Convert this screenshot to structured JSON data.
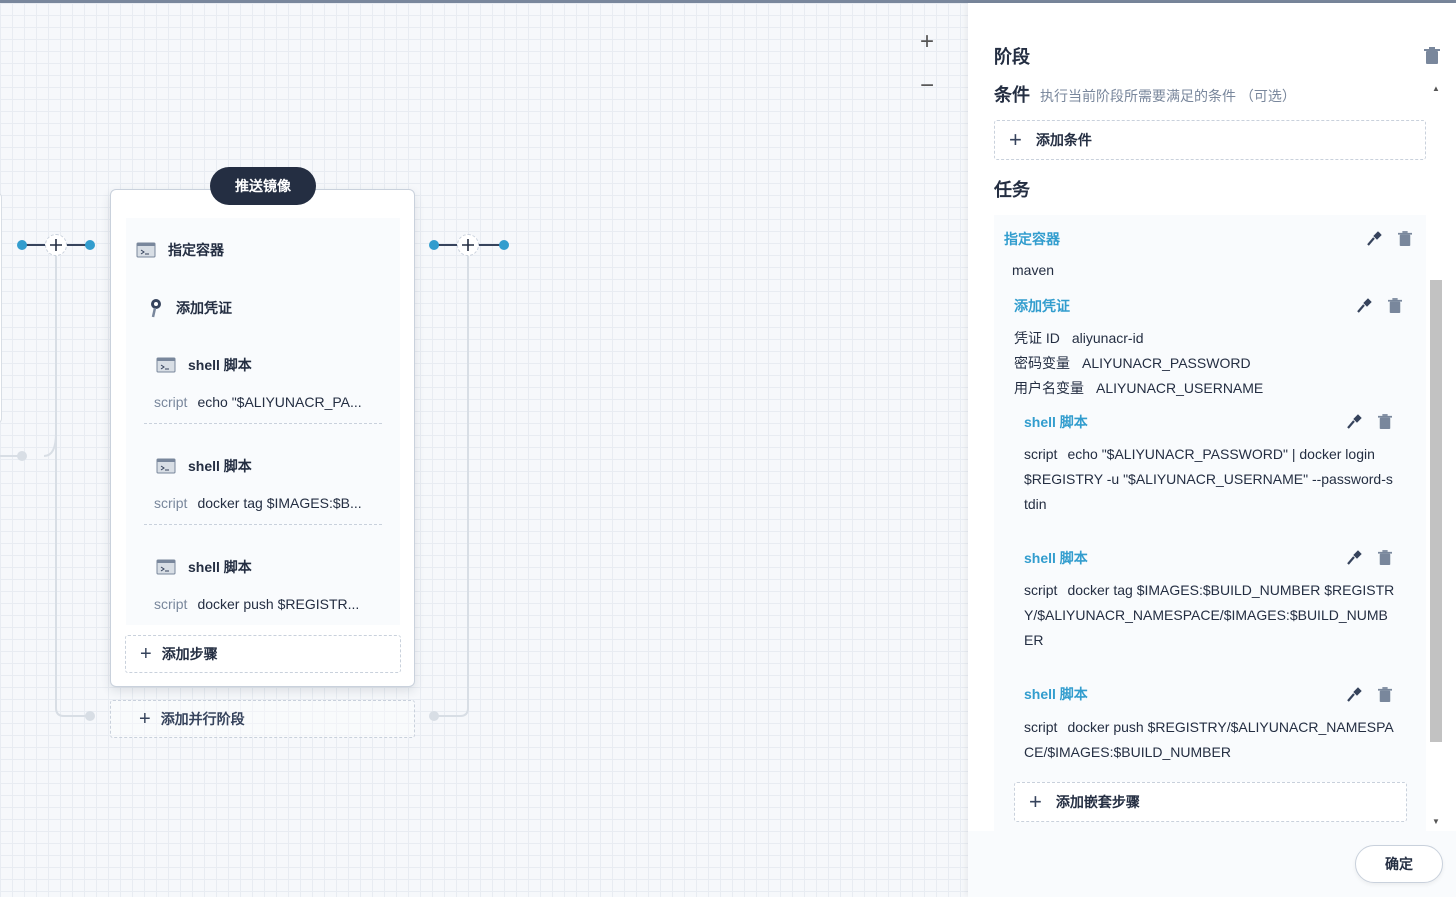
{
  "canvas": {
    "zoom_in_label": "+",
    "zoom_out_label": "−",
    "stage": {
      "title": "推送镜像",
      "steps": [
        {
          "title": "指定容器",
          "icon": "terminal-icon"
        },
        {
          "title": "添加凭证",
          "icon": "key-icon"
        },
        {
          "title": "shell 脚本",
          "icon": "terminal-icon",
          "script_key": "script",
          "script_value": "echo \"$ALIYUNACR_PA..."
        },
        {
          "title": "shell 脚本",
          "icon": "terminal-icon",
          "script_key": "script",
          "script_value": "docker tag $IMAGES:$B..."
        },
        {
          "title": "shell 脚本",
          "icon": "terminal-icon",
          "script_key": "script",
          "script_value": "docker push $REGISTR..."
        }
      ],
      "add_step_label": "添加步骤"
    },
    "add_parallel_label": "添加并行阶段"
  },
  "panel": {
    "title": "阶段",
    "condition_label": "条件",
    "condition_desc": "执行当前阶段所需要满足的条件 （可选）",
    "add_condition_label": "添加条件",
    "task_label": "任务",
    "container": {
      "title": "指定容器",
      "value": "maven"
    },
    "credential": {
      "title": "添加凭证",
      "fields": [
        {
          "key": "凭证 ID",
          "value": "aliyunacr-id"
        },
        {
          "key": "密码变量",
          "value": "ALIYUNACR_PASSWORD"
        },
        {
          "key": "用户名变量",
          "value": "ALIYUNACR_USERNAME"
        }
      ]
    },
    "shell_steps": [
      {
        "title": "shell 脚本",
        "key": "script",
        "value": "echo \"$ALIYUNACR_PASSWORD\" | docker login $REGISTRY -u \"$ALIYUNACR_USERNAME\" --password-stdin"
      },
      {
        "title": "shell 脚本",
        "key": "script",
        "value": "docker tag $IMAGES:$BUILD_NUMBER $REGISTRY/$ALIYUNACR_NAMESPACE/$IMAGES:$BUILD_NUMBER"
      },
      {
        "title": "shell 脚本",
        "key": "script",
        "value": "docker push $REGISTRY/$ALIYUNACR_NAMESPACE/$IMAGES:$BUILD_NUMBER"
      }
    ],
    "add_nested_label": "添加嵌套步骤",
    "confirm_label": "确定"
  },
  "colors": {
    "accent": "#329dce",
    "dark": "#242e42",
    "muted": "#79879c",
    "node_blue": "#329dce"
  }
}
